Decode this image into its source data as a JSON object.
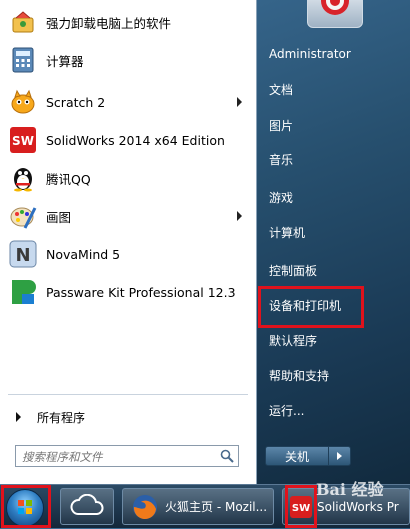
{
  "programs": [
    {
      "label": "强力卸载电脑上的软件",
      "icon": "uninstall-icon",
      "submenu": false
    },
    {
      "label": "计算器",
      "icon": "calculator-icon",
      "submenu": false
    },
    {
      "label": "Scratch 2",
      "icon": "scratch-icon",
      "submenu": true
    },
    {
      "label": "SolidWorks 2014 x64 Edition",
      "icon": "solidworks-icon",
      "submenu": false
    },
    {
      "label": "腾讯QQ",
      "icon": "qq-penguin-icon",
      "submenu": false
    },
    {
      "label": "画图",
      "icon": "paint-icon",
      "submenu": true
    },
    {
      "label": "NovaMind 5",
      "icon": "novamind-icon",
      "submenu": false
    },
    {
      "label": "Passware Kit Professional 12.3",
      "icon": "passware-icon",
      "submenu": false
    }
  ],
  "all_programs": "所有程序",
  "search": {
    "placeholder": "搜索程序和文件"
  },
  "right_items": [
    "Administrator",
    "文档",
    "图片",
    "音乐",
    "游戏",
    "计算机",
    "控制面板",
    "设备和打印机",
    "默认程序",
    "帮助和支持",
    "运行..."
  ],
  "shutdown_label": "关机",
  "taskbar": {
    "items": [
      {
        "label": "",
        "icon": "cloud-icon"
      },
      {
        "label": "火狐主页 - Mozil...",
        "icon": "firefox-icon"
      },
      {
        "label": "SolidWorks Pr",
        "icon": "solidworks-icon"
      }
    ]
  },
  "watermark": "Bai 经验",
  "colors": {
    "highlight": "#e0121c",
    "accent": "#2d5677"
  }
}
